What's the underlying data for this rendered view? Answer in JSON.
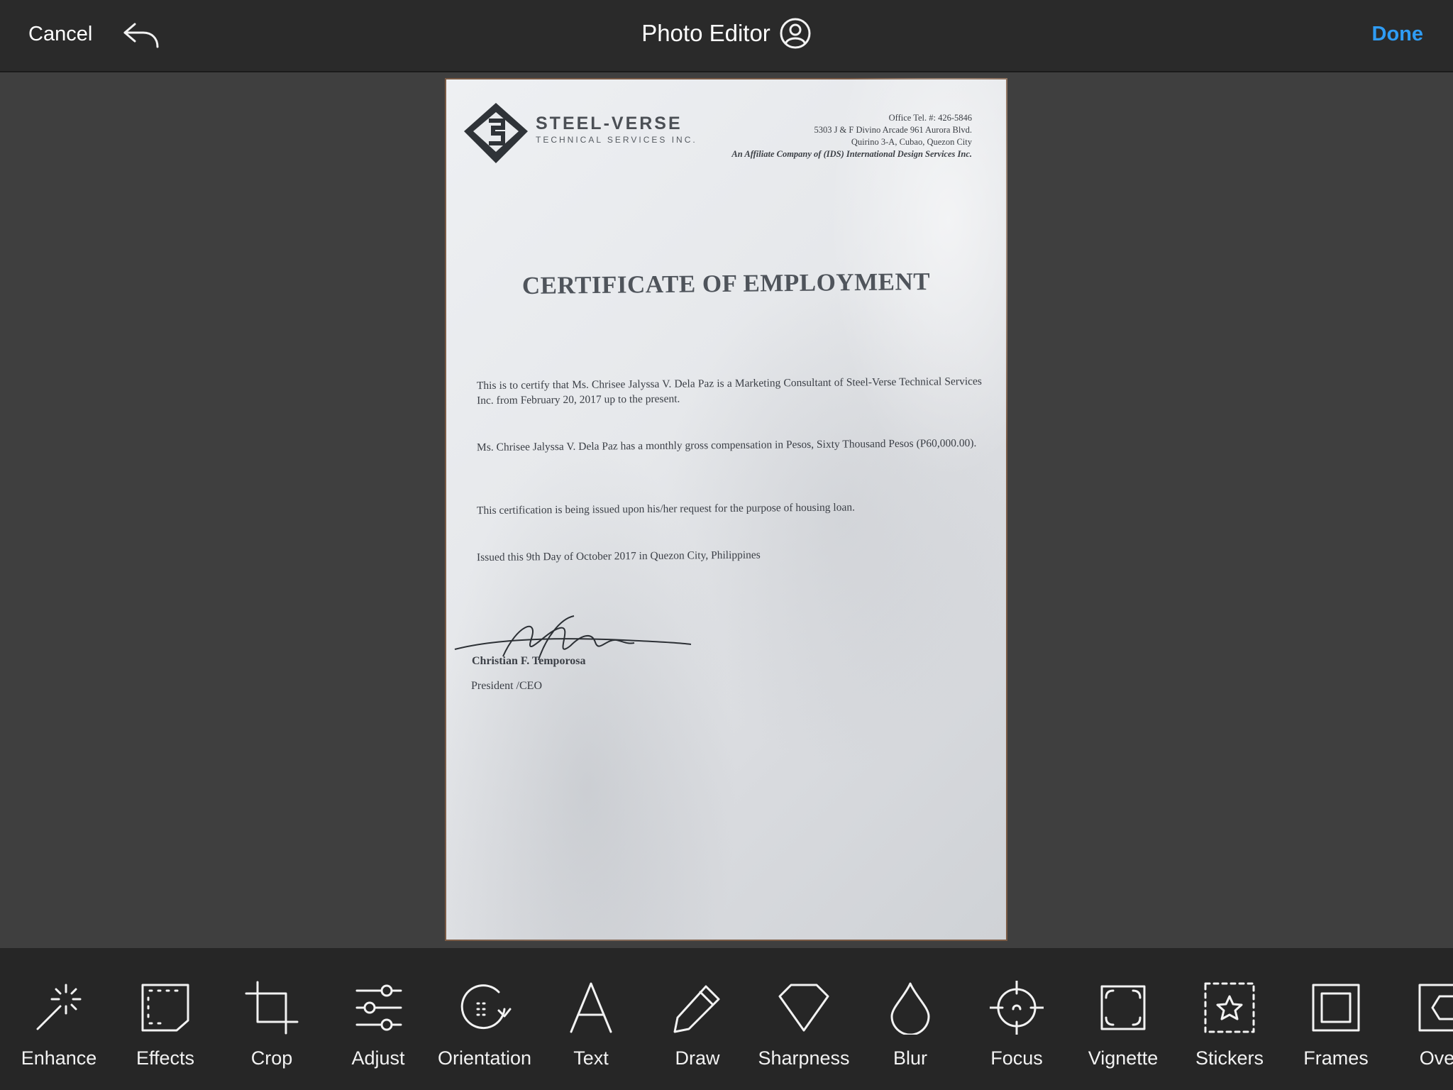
{
  "header": {
    "cancel_label": "Cancel",
    "title": "Photo Editor",
    "done_label": "Done",
    "done_color": "#2f9cf4",
    "icons": [
      "undo-icon",
      "account-icon"
    ]
  },
  "document": {
    "company_name": "STEEL-VERSE",
    "company_subtitle": "TECHNICAL SERVICES INC.",
    "office_lines": [
      "Office Tel. #: 426-5846",
      "5303 J & F Divino Arcade 961 Aurora Blvd.",
      "Quirino 3-A, Cubao, Quezon City",
      "An Affiliate Company of (IDS) International Design Services Inc."
    ],
    "title": "CERTIFICATE OF EMPLOYMENT",
    "paragraph1": "This is to certify that Ms. Chrisee Jalyssa V. Dela Paz is a Marketing Consultant of Steel-Verse Technical Services Inc. from February 20, 2017 up to the present.",
    "paragraph2": "Ms. Chrisee Jalyssa V. Dela Paz has a monthly gross compensation in Pesos, Sixty Thousand Pesos (P60,000.00).",
    "paragraph3": "This certification is being issued upon his/her request for the purpose of housing loan.",
    "paragraph4": "Issued this 9th Day of October 2017 in Quezon City, Philippines",
    "signer": "Christian F. Temporosa",
    "position": "President /CEO"
  },
  "toolbar": {
    "tools": [
      {
        "label": "Enhance",
        "icon": "magic-wand-icon"
      },
      {
        "label": "Effects",
        "icon": "film-frame-icon"
      },
      {
        "label": "Crop",
        "icon": "crop-icon"
      },
      {
        "label": "Adjust",
        "icon": "sliders-icon"
      },
      {
        "label": "Orientation",
        "icon": "rotate-icon"
      },
      {
        "label": "Text",
        "icon": "text-icon"
      },
      {
        "label": "Draw",
        "icon": "pencil-icon"
      },
      {
        "label": "Sharpness",
        "icon": "diamond-icon"
      },
      {
        "label": "Blur",
        "icon": "droplet-icon"
      },
      {
        "label": "Focus",
        "icon": "focus-target-icon"
      },
      {
        "label": "Vignette",
        "icon": "vignette-icon"
      },
      {
        "label": "Stickers",
        "icon": "star-sticker-icon"
      },
      {
        "label": "Frames",
        "icon": "frame-icon"
      },
      {
        "label": "Overl",
        "icon": "overlay-icon"
      }
    ]
  }
}
